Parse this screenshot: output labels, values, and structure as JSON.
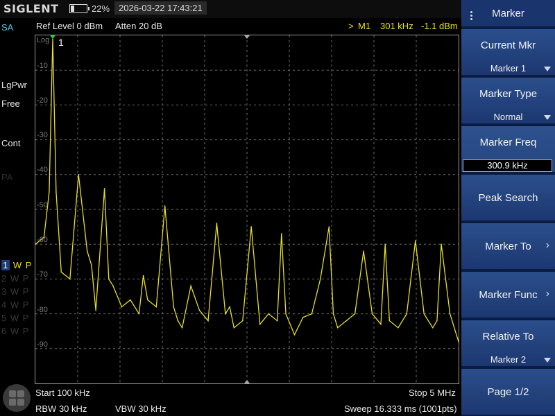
{
  "topbar": {
    "brand": "SIGLENT",
    "battery_pct": "22%",
    "battery_level": 0.22,
    "datetime": "2026-03-22 17:43:21"
  },
  "header": {
    "ref_level": "Ref Level  0 dBm",
    "atten": "Atten  20 dB",
    "marker_readout_arrow": ">",
    "marker_readout_name": "M1",
    "marker_readout_freq": "301 kHz",
    "marker_readout_level": "-1.1 dBm"
  },
  "left_panel": {
    "mode": "SA",
    "detector": "LgPwr",
    "avg": "Free",
    "sweep_mode": "Cont",
    "preamp": "PA",
    "traces": [
      {
        "num": "1",
        "w": "W",
        "p": "P",
        "active": true
      },
      {
        "num": "2",
        "w": "W",
        "p": "P",
        "active": false
      },
      {
        "num": "3",
        "w": "W",
        "p": "P",
        "active": false
      },
      {
        "num": "4",
        "w": "W",
        "p": "P",
        "active": false
      },
      {
        "num": "5",
        "w": "W",
        "p": "P",
        "active": false
      },
      {
        "num": "6",
        "w": "W",
        "p": "P",
        "active": false
      }
    ]
  },
  "plot": {
    "scale_label": "Log",
    "marker_label": "1",
    "y_ticks": [
      "-10",
      "-20",
      "-30",
      "-40",
      "-50",
      "-60",
      "-70",
      "-80",
      "-90"
    ],
    "colors": {
      "trace": "#e8e020",
      "grid": "#6e6e6e",
      "marker": "#20d040"
    }
  },
  "chart_data": {
    "type": "line",
    "title": "",
    "xlabel": "",
    "ylabel": "",
    "x_unit": "kHz",
    "y_unit": "dBm",
    "xlim": [
      100,
      5000
    ],
    "ylim": [
      -100,
      0
    ],
    "grid": true,
    "series": [
      {
        "name": "",
        "x": [
          100,
          200,
          260,
          301,
          340,
          400,
          500,
          600,
          700,
          750,
          800,
          900,
          950,
          1000,
          1100,
          1200,
          1300,
          1350,
          1400,
          1500,
          1600,
          1700,
          1750,
          1800,
          1900,
          2000,
          2100,
          2200,
          2300,
          2350,
          2400,
          2500,
          2600,
          2700,
          2800,
          2900,
          2950,
          3000,
          3100,
          3200,
          3300,
          3400,
          3500,
          3550,
          3600,
          3700,
          3800,
          3900,
          4000,
          4100,
          4150,
          4200,
          4300,
          4400,
          4500,
          4600,
          4700,
          4750,
          4800,
          4900,
          5000
        ],
        "values": [
          -60,
          -58,
          -45,
          -1.1,
          -45,
          -68,
          -70,
          -40,
          -62,
          -66,
          -79,
          -44,
          -70,
          -72,
          -78,
          -76,
          -80,
          -69,
          -76,
          -78,
          -49,
          -78,
          -82,
          -84,
          -72,
          -79,
          -82,
          -54,
          -80,
          -78,
          -84,
          -82,
          -55,
          -83,
          -80,
          -82,
          -57,
          -80,
          -86,
          -81,
          -80,
          -70,
          -55,
          -80,
          -84,
          -82,
          -80,
          -62,
          -80,
          -83,
          -60,
          -82,
          -84,
          -80,
          -59,
          -80,
          -84,
          -82,
          -60,
          -80,
          -88
        ]
      }
    ]
  },
  "bottom": {
    "start": "Start  100 kHz",
    "stop": "Stop  5 MHz",
    "rbw": "RBW  30 kHz",
    "vbw": "VBW  30 kHz",
    "sweep": "Sweep  16.333 ms (1001pts)"
  },
  "softkeys": {
    "title": "Marker",
    "current_mkr": {
      "label": "Current Mkr",
      "value": "Marker 1"
    },
    "marker_type": {
      "label": "Marker Type",
      "value": "Normal"
    },
    "marker_freq": {
      "label": "Marker Freq",
      "value": "300.9 kHz"
    },
    "peak_search": {
      "label": "Peak Search"
    },
    "marker_to": {
      "label": "Marker To",
      "chevron": "›"
    },
    "marker_func": {
      "label": "Marker Func",
      "chevron": "›"
    },
    "relative_to": {
      "label": "Relative To",
      "value": "Marker 2"
    },
    "page": {
      "label": "Page 1/2"
    }
  }
}
